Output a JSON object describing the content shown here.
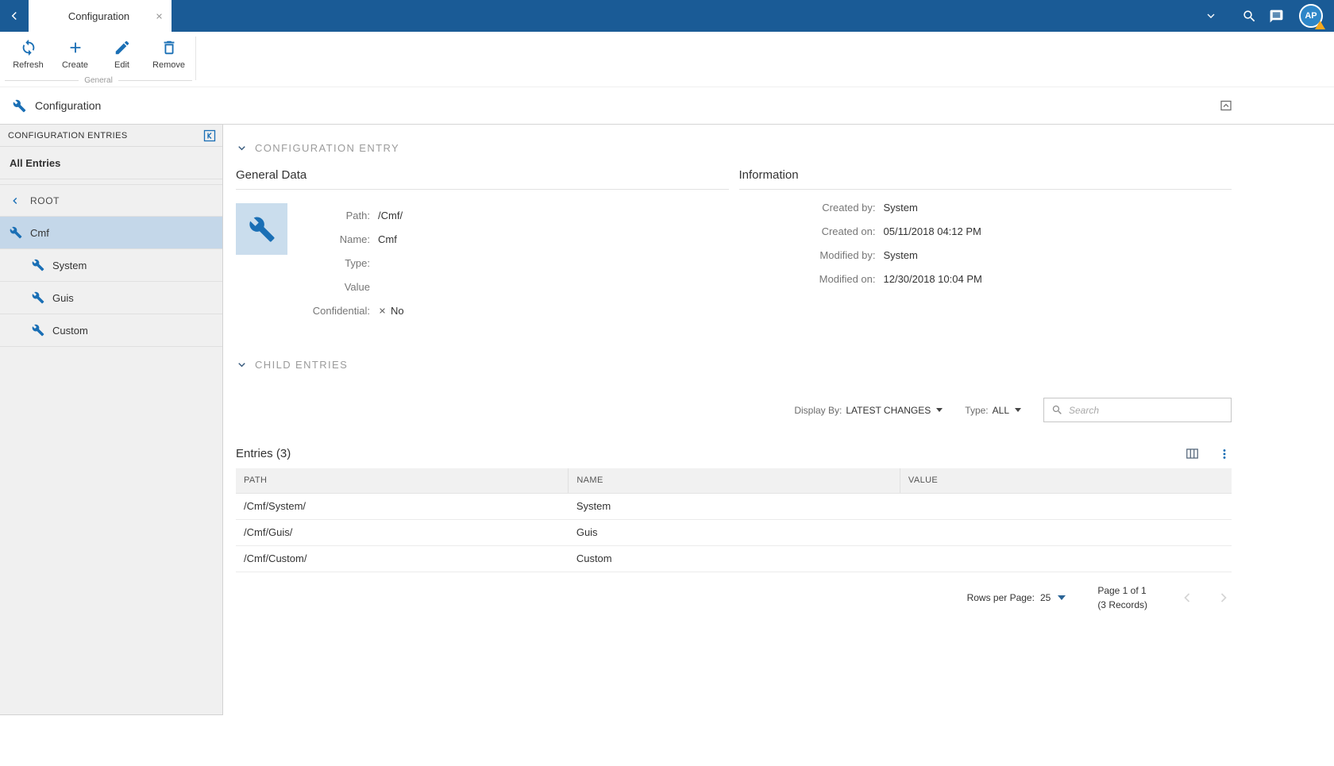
{
  "colors": {
    "topbar": "#1a5b96",
    "accent": "#1a6fb5",
    "selected_item_bg": "#c4d7e9",
    "tile_bg": "#cadded",
    "warning_badge": "#f5a81e"
  },
  "topbar": {
    "tab_title": "Configuration",
    "avatar_initials": "AP"
  },
  "toolbar": {
    "group_label": "General",
    "buttons": [
      {
        "label": "Refresh"
      },
      {
        "label": "Create"
      },
      {
        "label": "Edit"
      },
      {
        "label": "Remove"
      }
    ]
  },
  "breadcrumb": {
    "title": "Configuration"
  },
  "sidebar": {
    "header": "CONFIGURATION ENTRIES",
    "all_entries_label": "All Entries",
    "root_label": "ROOT",
    "items": [
      {
        "label": "Cmf",
        "selected": true
      },
      {
        "label": "System"
      },
      {
        "label": "Guis"
      },
      {
        "label": "Custom"
      }
    ]
  },
  "entry_section": {
    "title": "CONFIGURATION ENTRY",
    "general_data": {
      "title": "General Data",
      "fields": [
        {
          "label": "Path:",
          "value": "/Cmf/"
        },
        {
          "label": "Name:",
          "value": "Cmf"
        },
        {
          "label": "Type:",
          "value": ""
        },
        {
          "label": "Value",
          "value": ""
        },
        {
          "label": "Confidential:",
          "value": "No"
        }
      ]
    },
    "information": {
      "title": "Information",
      "fields": [
        {
          "label": "Created by:",
          "value": "System"
        },
        {
          "label": "Created on:",
          "value": "05/11/2018 04:12 PM"
        },
        {
          "label": "Modified by:",
          "value": "System"
        },
        {
          "label": "Modified on:",
          "value": "12/30/2018 10:04 PM"
        }
      ]
    }
  },
  "child_section": {
    "title": "CHILD ENTRIES",
    "display_by_label": "Display By:",
    "display_by_value": "LATEST CHANGES",
    "type_label": "Type:",
    "type_value": "ALL",
    "search_placeholder": "Search"
  },
  "table": {
    "title": "Entries (3)",
    "columns": [
      "PATH",
      "NAME",
      "VALUE"
    ],
    "rows": [
      {
        "path": "/Cmf/System/",
        "name": "System",
        "value": ""
      },
      {
        "path": "/Cmf/Guis/",
        "name": "Guis",
        "value": ""
      },
      {
        "path": "/Cmf/Custom/",
        "name": "Custom",
        "value": ""
      }
    ]
  },
  "pagination": {
    "rows_per_page_label": "Rows per Page:",
    "rows_per_page_value": "25",
    "page_label": "Page 1 of 1",
    "records_label": "(3 Records)"
  }
}
